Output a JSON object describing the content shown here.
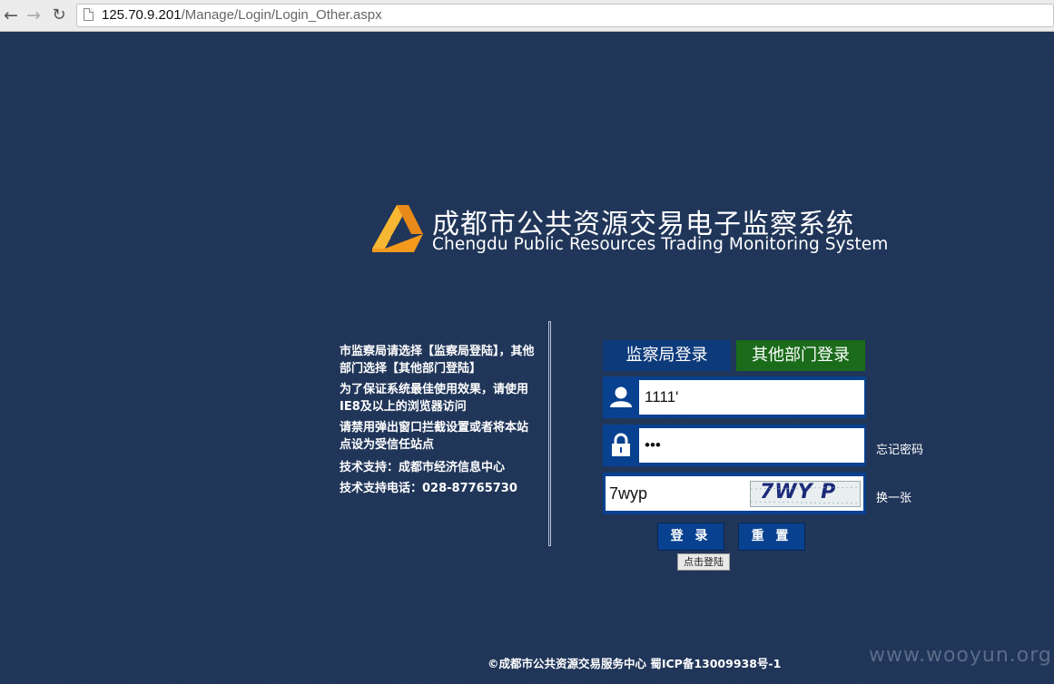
{
  "browser": {
    "url_host": "125.70.9.201",
    "url_path": "/Manage/Login/Login_Other.aspx"
  },
  "header": {
    "title_zh": "成都市公共资源交易电子监察系统",
    "title_en": "Chengdu Public Resources Trading Monitoring System"
  },
  "notice": {
    "line1": "市监察局请选择【监察局登陆】，其他部门选择【其他部门登陆】",
    "line2": "为了保证系统最佳使用效果，请使用IE8及以上的浏览器访问",
    "line3": "请禁用弹出窗口拦截设置或者将本站点设为受信任站点",
    "support": "技术支持：成都市经济信息中心",
    "phone": "技术支持电话：028-87765730"
  },
  "login": {
    "tab_jcj": "监察局登录",
    "tab_other": "其他部门登录",
    "username_value": "1111'",
    "password_value": "•••",
    "captcha_value": "7wyp",
    "captcha_image_text": "7WY P",
    "forgot_password": "忘记密码",
    "change_captcha": "换一张",
    "login_button": "登 录",
    "reset_button": "重 置",
    "login_tooltip": "点击登陆"
  },
  "footer": {
    "copyright": "©成都市公共资源交易服务中心 蜀ICP备13009938号-1"
  },
  "watermark": "www.wooyun.org",
  "colors": {
    "background": "#1f3559",
    "tab_jcj": "#0d3a7a",
    "tab_other": "#1a6b1a",
    "field_frame": "#08418f",
    "logo_orange": "#f5a623"
  }
}
